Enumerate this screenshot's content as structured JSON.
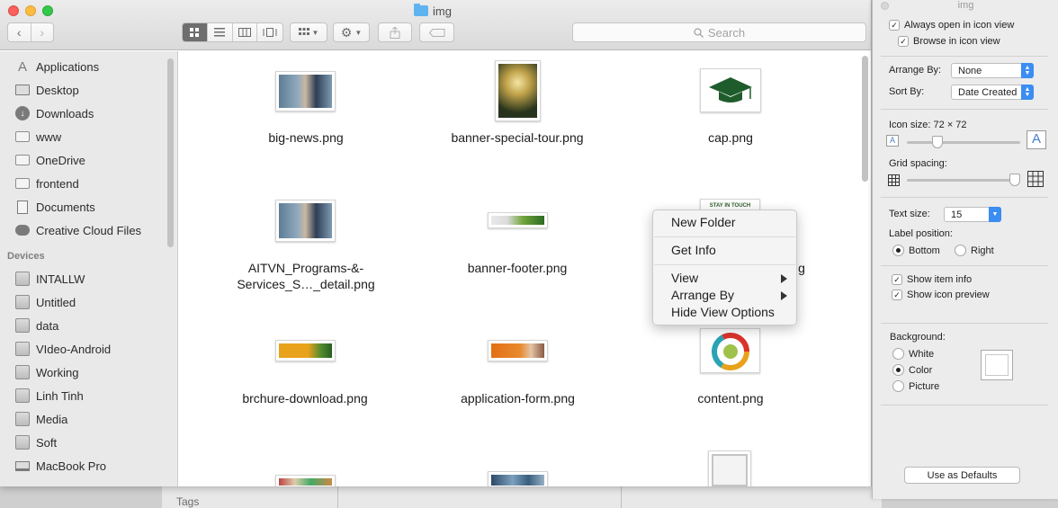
{
  "window": {
    "title": "img"
  },
  "toolbar": {
    "search_placeholder": "Search",
    "view_modes": [
      "icon",
      "list",
      "column",
      "cover-flow"
    ]
  },
  "sidebar": {
    "favorites": [
      {
        "label": "Applications",
        "icon": "applications-icon"
      },
      {
        "label": "Desktop",
        "icon": "desktop-icon"
      },
      {
        "label": "Downloads",
        "icon": "downloads-icon"
      },
      {
        "label": "www",
        "icon": "folder-icon"
      },
      {
        "label": "OneDrive",
        "icon": "folder-icon"
      },
      {
        "label": "frontend",
        "icon": "folder-icon"
      },
      {
        "label": "Documents",
        "icon": "documents-icon"
      },
      {
        "label": "Creative Cloud Files",
        "icon": "creative-cloud-icon"
      }
    ],
    "devices_heading": "Devices",
    "devices": [
      {
        "label": "INTALLW"
      },
      {
        "label": "Untitled"
      },
      {
        "label": "data"
      },
      {
        "label": "VIdeo-Android"
      },
      {
        "label": "Working"
      },
      {
        "label": "Linh Tinh"
      },
      {
        "label": "Media"
      },
      {
        "label": "Soft"
      },
      {
        "label": "MacBook Pro"
      }
    ]
  },
  "files": [
    {
      "name": "big-news.png"
    },
    {
      "name": "banner-special-tour.png"
    },
    {
      "name": "cap.png"
    },
    {
      "name": "AITVN_Programs-&-",
      "name2": "Services_S…_detail.png"
    },
    {
      "name": "banner-footer.png"
    },
    {
      "name": "g"
    },
    {
      "name": "brchure-download.png"
    },
    {
      "name": "application-form.png"
    },
    {
      "name": "content.png"
    }
  ],
  "context_menu": {
    "items": [
      "New Folder",
      "Get Info",
      "View",
      "Arrange By",
      "Hide View Options"
    ]
  },
  "view_options": {
    "title": "img",
    "always_open": "Always open in icon view",
    "browse_in": "Browse in icon view",
    "arrange_by_label": "Arrange By:",
    "arrange_by_value": "None",
    "sort_by_label": "Sort By:",
    "sort_by_value": "Date Created",
    "icon_size_label": "Icon size:  72 × 72",
    "grid_spacing_label": "Grid spacing:",
    "text_size_label": "Text size:",
    "text_size_value": "15",
    "label_position_label": "Label position:",
    "label_bottom": "Bottom",
    "label_right": "Right",
    "show_item_info": "Show item info",
    "show_icon_preview": "Show icon preview",
    "background_label": "Background:",
    "bg_white": "White",
    "bg_color": "Color",
    "bg_picture": "Picture",
    "use_defaults": "Use as Defaults"
  },
  "background_window": {
    "tags_label": "Tags"
  }
}
